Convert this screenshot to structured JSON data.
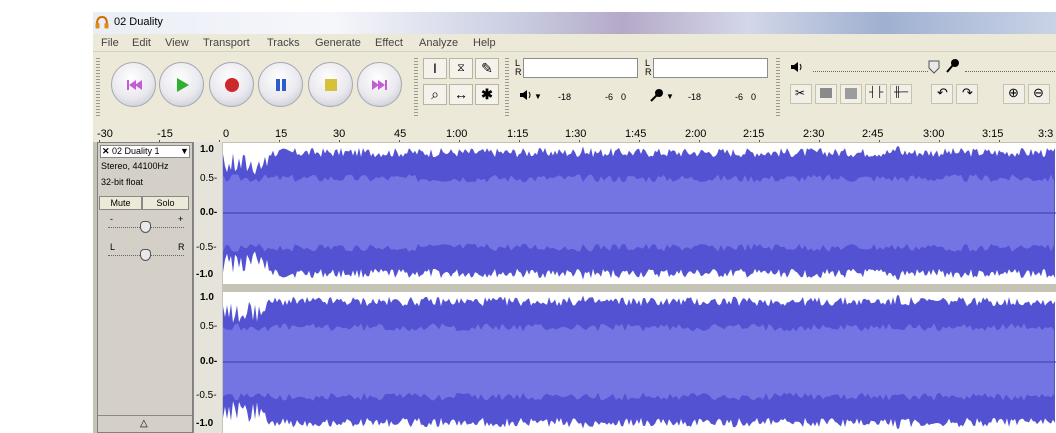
{
  "window": {
    "title": "02 Duality"
  },
  "menu": [
    "File",
    "Edit",
    "View",
    "Transport",
    "Tracks",
    "Generate",
    "Effect",
    "Analyze",
    "Help"
  ],
  "meters": {
    "left_ch": "L",
    "right_ch": "R",
    "output_scale": [
      "-18",
      "-6",
      "0"
    ],
    "input_scale": [
      "-18",
      "-6",
      "0"
    ]
  },
  "ruler": [
    "-30",
    "-15",
    "0",
    "15",
    "30",
    "45",
    "1:00",
    "1:15",
    "1:30",
    "1:45",
    "2:00",
    "2:15",
    "2:30",
    "2:45",
    "3:00",
    "3:15",
    "3:3"
  ],
  "track": {
    "name": "02 Duality 1",
    "dropdown_arrow": "▼",
    "format": "Stereo, 44100Hz",
    "depth": "32-bit float",
    "mute": "Mute",
    "solo": "Solo",
    "gain_minus": "-",
    "gain_plus": "+",
    "pan_left": "L",
    "pan_right": "R",
    "collapse_arrow": "△"
  },
  "scale": [
    "1.0",
    "0.5-",
    "0.0-",
    "-0.5-",
    "-1.0"
  ],
  "colors": {
    "wave": "#5252d2",
    "wave_peak": "#3939b8",
    "accent": "#4b4bd0"
  }
}
